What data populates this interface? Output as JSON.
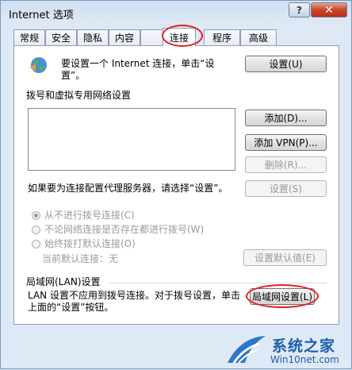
{
  "window": {
    "title": "Internet 选项",
    "help_label": "?",
    "close_label": "✕"
  },
  "tabs": [
    {
      "label": "常规",
      "active": false
    },
    {
      "label": "安全",
      "active": false
    },
    {
      "label": "隐私",
      "active": false
    },
    {
      "label": "内容",
      "active": false
    },
    {
      "label": "连接",
      "active": true
    },
    {
      "label": "程序",
      "active": false
    },
    {
      "label": "高级",
      "active": false
    }
  ],
  "setup": {
    "text_line1": "要设置一个 Internet 连接，单击“设",
    "text_line2": "置”。",
    "button": "设置(U)"
  },
  "dialup": {
    "heading": "拨号和虚拟专用网络设置",
    "add_button": "添加(D)...",
    "add_vpn_button": "添加 VPN(P)...",
    "remove_button": "删除(R)...",
    "proxy_text": "如果要为连接配置代理服务器，请选择“设置”。",
    "settings_button": "设置(S)",
    "radio_never": "从不进行拨号连接(C)",
    "radio_when_none": "不论网络连接是否存在都进行拨号(W)",
    "radio_always": "始终拨打默认连接(O)",
    "current_default": "当前默认连接：无",
    "set_default_button": "设置默认值(E)"
  },
  "lan": {
    "heading": "局域网(LAN)设置",
    "text_line1": "LAN 设置不应用到拨号连接。对于拨号设置，单击",
    "text_line2": "上面的“设置”按钮。",
    "button": "局域网设置(L)"
  },
  "watermark": {
    "name": "系统之家",
    "url": "Win10net.com"
  }
}
